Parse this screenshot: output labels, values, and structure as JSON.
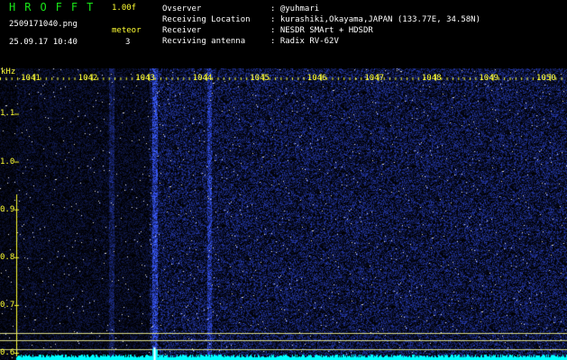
{
  "header": {
    "app_title": "HROFFT",
    "version": "1.00f",
    "file_name": "2509171040.png",
    "mode": "meteor",
    "datetime": "25.09.17 10:40",
    "count": "3"
  },
  "meta": {
    "observer_label": "Ovserver",
    "observer_value": ": @yuhmari",
    "location_label": "Receiving Location",
    "location_value": ": kurashiki,Okayama,JAPAN (133.77E, 34.58N)",
    "receiver_label": "Receiver",
    "receiver_value": ": NESDR SMArt + HDSDR",
    "antenna_label": "Recviving antenna",
    "antenna_value": ": Radix RV-62V"
  },
  "chart_data": {
    "type": "heatmap",
    "x_unit": "kHz",
    "x_ticks": [
      "1041",
      "1042",
      "1043",
      "1044",
      "1045",
      "1046",
      "1047",
      "1048",
      "1049",
      "1050"
    ],
    "x_range": [
      1040.4,
      1050.3
    ],
    "y_ticks": [
      "1.1",
      "1.0",
      "0.9",
      "0.8",
      "0.7",
      "0.6"
    ],
    "y_range": [
      0.585,
      1.195
    ],
    "colors": {
      "background": "#000000",
      "signal": "#3a46ff",
      "strong": "#ffffff",
      "baseline": "#00ffff"
    }
  }
}
